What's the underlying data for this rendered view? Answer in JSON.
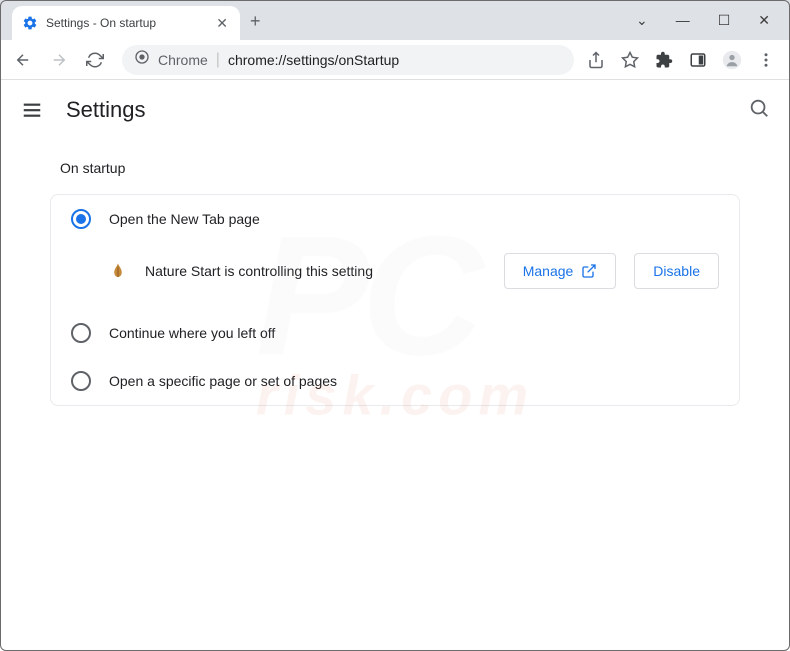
{
  "window": {
    "tab_title": "Settings - On startup"
  },
  "address": {
    "prefix": "Chrome",
    "path": "chrome://settings/onStartup"
  },
  "header": {
    "title": "Settings"
  },
  "section": {
    "title": "On startup"
  },
  "options": {
    "opt1": "Open the New Tab page",
    "opt2": "Continue where you left off",
    "opt3": "Open a specific page or set of pages"
  },
  "controlled": {
    "text": "Nature Start is controlling this setting",
    "manage": "Manage",
    "disable": "Disable"
  },
  "watermark": {
    "main": "PC",
    "sub": "risk.com"
  }
}
